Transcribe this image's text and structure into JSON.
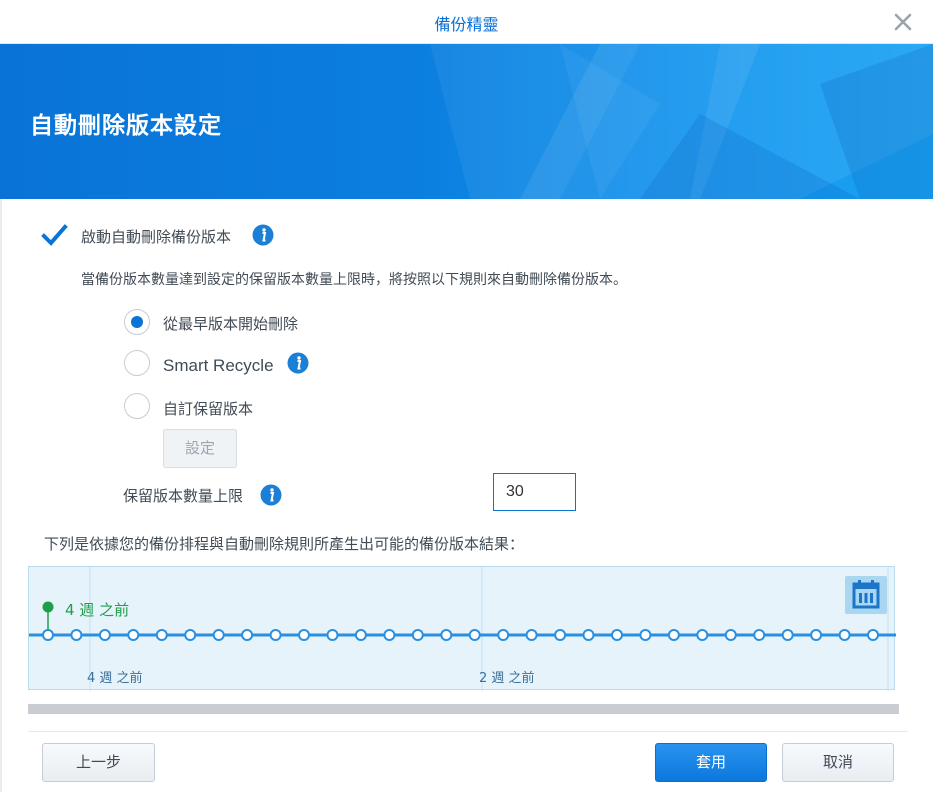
{
  "window": {
    "title": "備份精靈"
  },
  "banner": {
    "heading": "自動刪除版本設定"
  },
  "auto_delete": {
    "checkbox_label": "啟動自動刪除備份版本",
    "checked": true,
    "description": "當備份版本數量達到設定的保留版本數量上限時，將按照以下規則來自動刪除備份版本。"
  },
  "rules": {
    "options": [
      {
        "label": "從最早版本開始刪除",
        "selected": true
      },
      {
        "label": "Smart Recycle",
        "selected": false
      },
      {
        "label": "自訂保留版本",
        "selected": false
      }
    ],
    "settings_button": "設定"
  },
  "retention": {
    "label": "保留版本數量上限",
    "value": "30"
  },
  "results": {
    "description": "下列是依據您的備份排程與自動刪除規則所產生出可能的備份版本結果：",
    "current_marker": "4 週 之前",
    "axis_labels": [
      "4 週 之前",
      "2 週 之前"
    ],
    "version_count": 30
  },
  "footer": {
    "back": "上一步",
    "apply": "套用",
    "cancel": "取消"
  },
  "colors": {
    "accent": "#0a73d6",
    "marker": "#1e9f4a",
    "timeline_bg": "#e6f3fb"
  },
  "icons": [
    "close-icon",
    "checkmark-icon",
    "info-icon",
    "calendar-icon"
  ]
}
